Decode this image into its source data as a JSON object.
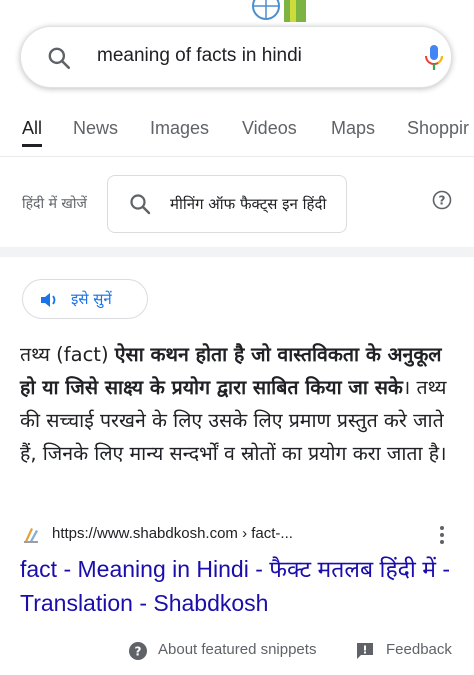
{
  "search": {
    "query": "meaning of facts in hindi"
  },
  "tabs": [
    {
      "label": "All"
    },
    {
      "label": "News"
    },
    {
      "label": "Images"
    },
    {
      "label": "Videos"
    },
    {
      "label": "Maps"
    },
    {
      "label": "Shoppir"
    }
  ],
  "hindi_search": {
    "label": "हिंदी में खोजें",
    "query": "मीनिंग ऑफ फैक्ट्स इन हिंदी"
  },
  "snippet": {
    "listen_label": "इसे सुनें",
    "text_plain_start": "तथ्य (fact) ",
    "text_bold": "ऐसा कथन होता है जो वास्तविकता के अनुकूल हो या जिसे साक्ष्य के प्रयोग द्वारा साबित किया जा सके",
    "text_plain_end": "। तथ्य की सच्चाई परखने के लिए उसके लिए प्रमाण प्रस्तुत करे जाते हैं, जिनके लिए मान्य सन्दर्भों व स्रोतों का प्रयोग करा जाता है।",
    "source_url": "https://www.shabdkosh.com › fact-...",
    "result_title": "fact - Meaning in Hindi - फैक्ट मतलब हिंदी में - Translation - Shabdkosh"
  },
  "footer": {
    "about_label": "About featured snippets",
    "feedback_label": "Feedback"
  },
  "colors": {
    "link": "#1a0dab",
    "accent": "#1a73e8",
    "muted": "#5f6368"
  }
}
